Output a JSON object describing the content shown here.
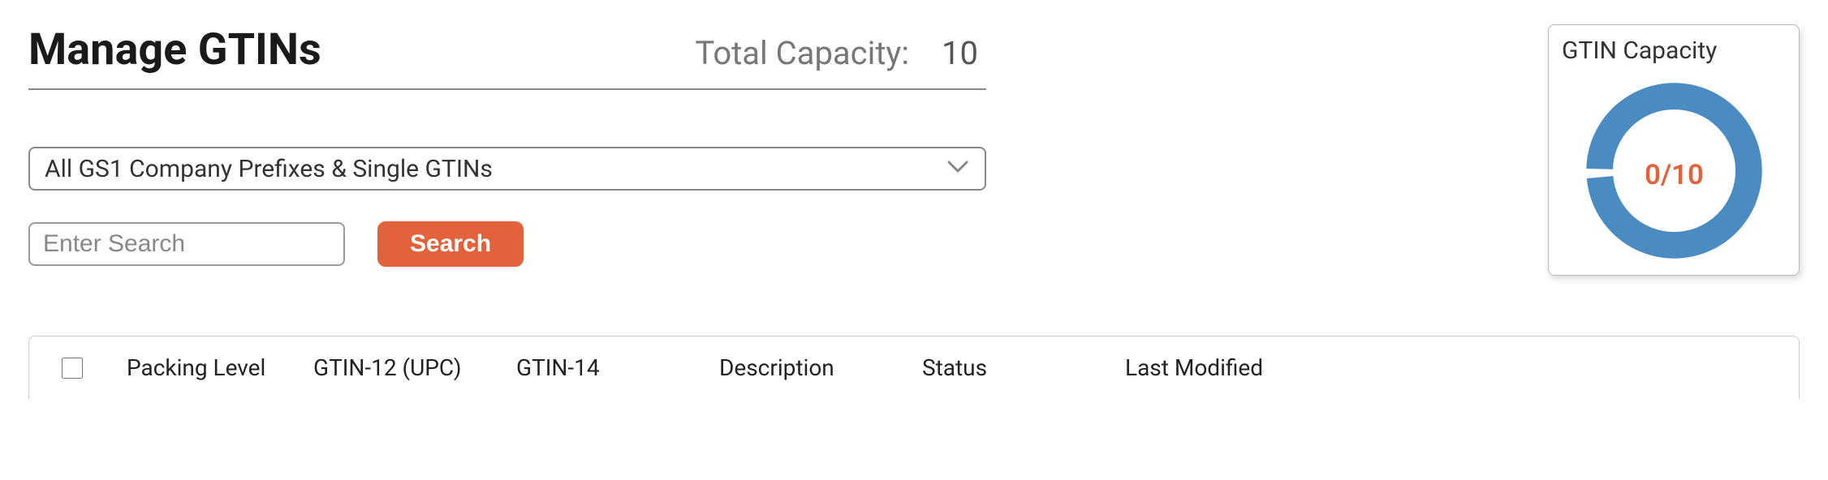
{
  "header": {
    "title": "Manage GTINs",
    "total_capacity_label": "Total Capacity:",
    "total_capacity_value": "10"
  },
  "prefix_select": {
    "selected_label": "All GS1 Company Prefixes & Single GTINs"
  },
  "search": {
    "placeholder": "Enter Search",
    "value": "",
    "button_label": "Search"
  },
  "capacity_card": {
    "title": "GTIN Capacity",
    "center_text": "0/10",
    "used": 0,
    "total": 10
  },
  "table": {
    "columns": {
      "packing_level": "Packing Level",
      "gtin12": "GTIN-12 (UPC)",
      "gtin14": "GTIN-14",
      "description": "Description",
      "status": "Status",
      "last_modified": "Last Modified"
    }
  },
  "colors": {
    "accent": "#e2623b",
    "donut_ring": "#4a8bc2"
  }
}
